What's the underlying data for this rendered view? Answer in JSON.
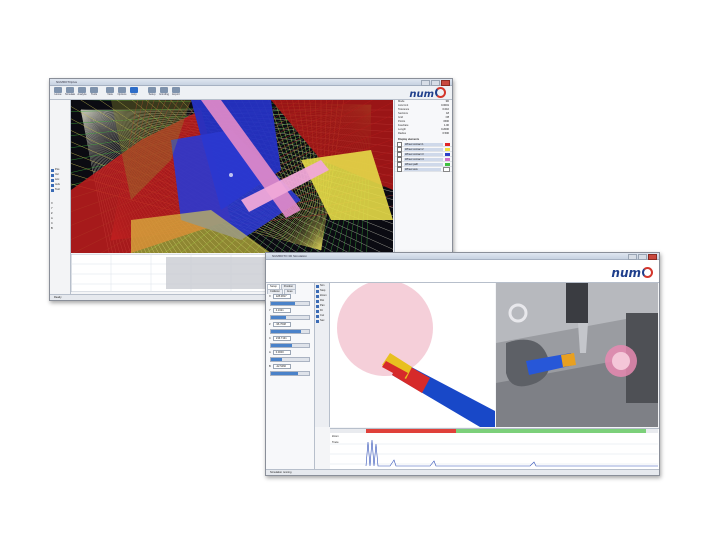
{
  "brand": {
    "logo_text": "num"
  },
  "window1": {
    "title": "NUMROTOplus",
    "ribbon": [
      "Home",
      "Simulate",
      "Analyze",
      "Tools",
      "View",
      "Options",
      "Help",
      "Setup",
      "Grinding",
      "Export"
    ],
    "left_tools": [
      "Pos",
      "Vel",
      "Acc",
      "Jerk",
      "Tool"
    ],
    "left_values": [
      "X",
      "Y",
      "Z",
      "A",
      "C",
      "B"
    ],
    "properties": [
      {
        "label": "Mode",
        "value": "3D"
      },
      {
        "label": "Axis limit",
        "value": "0.0001"
      },
      {
        "label": "Tolerance",
        "value": "0.010"
      },
      {
        "label": "Sections",
        "value": "18"
      },
      {
        "label": "Grid",
        "value": "Off"
      },
      {
        "label": "Points",
        "value": "1500"
      },
      {
        "label": "Feedrate",
        "value": "1.00"
      },
      {
        "label": "Length",
        "value": "0.2000"
      },
      {
        "label": "Radius",
        "value": "0.500"
      }
    ],
    "legend_title": "Display elements",
    "legend": [
      {
        "name": "Wheel contact 1",
        "color": "#e02828"
      },
      {
        "name": "Wheel contact 2",
        "color": "#f0e040"
      },
      {
        "name": "Wheel contact 3",
        "color": "#2c40c8"
      },
      {
        "name": "Wheel contact 4",
        "color": "#d070c8"
      },
      {
        "name": "Wheel path",
        "color": "#40c040"
      },
      {
        "name": "Wheel axis",
        "color": "#ffffff"
      }
    ],
    "status": "Ready"
  },
  "window2": {
    "title": "NUMROTO 3D Simulation",
    "tabs": [
      "Setup",
      "Position",
      "Collision",
      "Axes"
    ],
    "fields": [
      {
        "label": "X",
        "value": "128.0817"
      },
      {
        "label": "Y",
        "value": "4.1621"
      },
      {
        "label": "Z",
        "value": "-96.7648"
      },
      {
        "label": "C",
        "value": "236.7131"
      },
      {
        "label": "A",
        "value": "0.0000"
      },
      {
        "label": "B",
        "value": "-22.5460"
      }
    ],
    "slider_levels": [
      0.62,
      0.4,
      0.78,
      0.55,
      0.3,
      0.7
    ],
    "right_tools": [
      "Sim",
      "Step",
      "Zoom",
      "Rot",
      "Pan",
      "Fit",
      "Cut",
      "Sec"
    ],
    "timeline_labels": [
      "Zoom",
      "Trace"
    ],
    "status": "Simulation running"
  },
  "colors": {
    "accent": "#1f3f8c",
    "logo_red": "#d3362c",
    "progress_red": "#e0403a",
    "progress_green": "#7cd07a"
  }
}
